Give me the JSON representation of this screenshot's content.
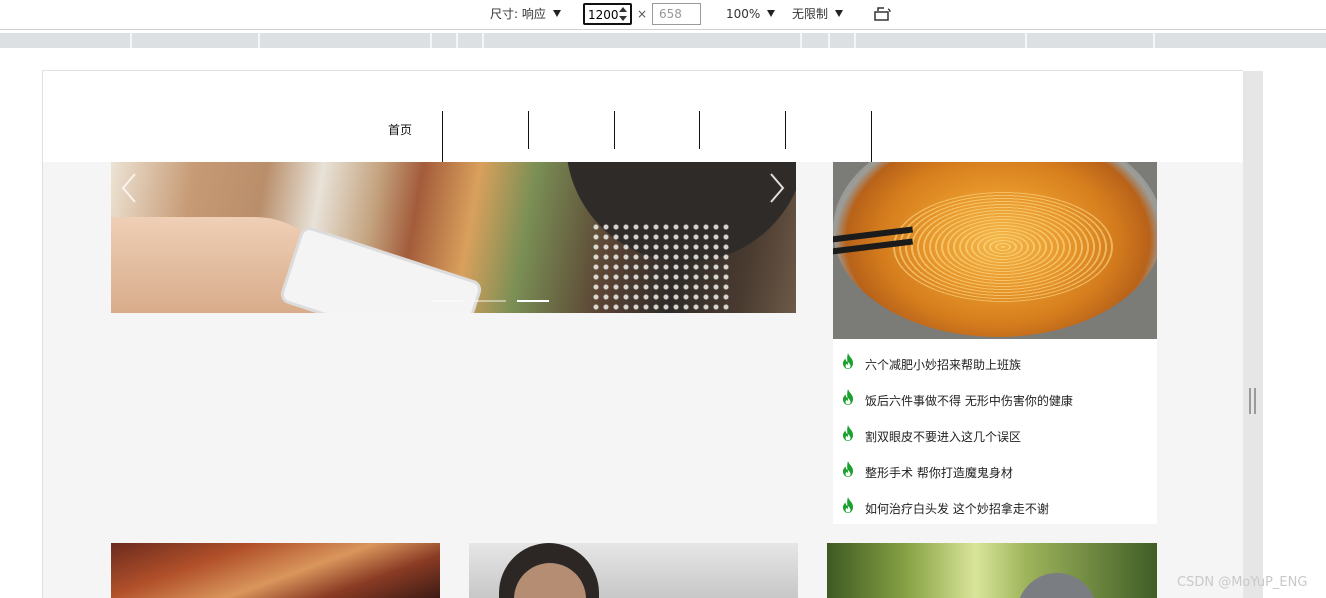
{
  "devtools": {
    "dimensions_label": "尺寸: 响应",
    "width_value": "1200",
    "times_sign": "×",
    "height_placeholder": "658",
    "zoom": "100%",
    "throttle": "无限制"
  },
  "site": {
    "nav": {
      "home": "首页"
    },
    "hot_list": [
      {
        "title": "六个减肥小妙招来帮助上班族"
      },
      {
        "title": "饭后六件事做不得 无形中伤害你的健康"
      },
      {
        "title": "割双眼皮不要进入这几个误区"
      },
      {
        "title": "整形手术 帮你打造魔鬼身材"
      },
      {
        "title": "如何治疗白头发 这个妙招拿走不谢"
      }
    ],
    "carousel": {
      "slide_count": 3,
      "active_index": 2
    },
    "colors": {
      "fire_icon": "#1aa02e",
      "page_bg": "#f5f5f5"
    }
  },
  "watermark": "CSDN @MoYuP_ENG"
}
